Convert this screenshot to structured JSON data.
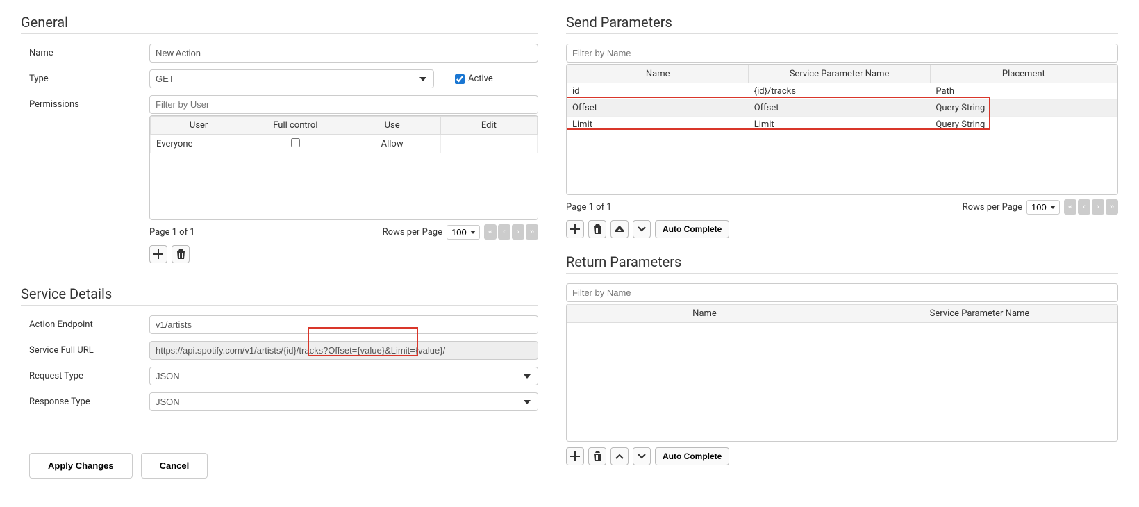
{
  "general": {
    "title": "General",
    "name_label": "Name",
    "name_value": "New Action",
    "type_label": "Type",
    "type_value": "GET",
    "active_label": "Active",
    "active_checked": true,
    "permissions_label": "Permissions",
    "perm_filter_placeholder": "Filter by User",
    "perm_headers": [
      "User",
      "Full control",
      "Use",
      "Edit"
    ],
    "perm_rows": [
      {
        "user": "Everyone",
        "full_control": false,
        "use": "Allow",
        "edit": ""
      }
    ],
    "page_info": "Page 1 of 1",
    "rows_label": "Rows per Page",
    "rows_value": "100"
  },
  "service": {
    "title": "Service Details",
    "endpoint_label": "Action Endpoint",
    "endpoint_value": "v1/artists",
    "url_label": "Service Full URL",
    "url_value": "https://api.spotify.com/v1/artists/{id}/tracks?Offset={value}&Limit={value}/",
    "request_label": "Request Type",
    "request_value": "JSON",
    "response_label": "Response Type",
    "response_value": "JSON"
  },
  "buttons": {
    "apply": "Apply Changes",
    "cancel": "Cancel",
    "auto_complete": "Auto Complete"
  },
  "send_params": {
    "title": "Send Parameters",
    "filter_placeholder": "Filter by Name",
    "headers": [
      "Name",
      "Service Parameter Name",
      "Placement"
    ],
    "rows": [
      {
        "name": "id",
        "svc": "{id}/tracks",
        "placement": "Path"
      },
      {
        "name": "Offset",
        "svc": "Offset",
        "placement": "Query String"
      },
      {
        "name": "Limit",
        "svc": "Limit",
        "placement": "Query String"
      }
    ],
    "page_info": "Page 1 of 1",
    "rows_label": "Rows per Page",
    "rows_value": "100"
  },
  "return_params": {
    "title": "Return Parameters",
    "filter_placeholder": "Filter by Name",
    "headers": [
      "Name",
      "Service Parameter Name"
    ]
  }
}
